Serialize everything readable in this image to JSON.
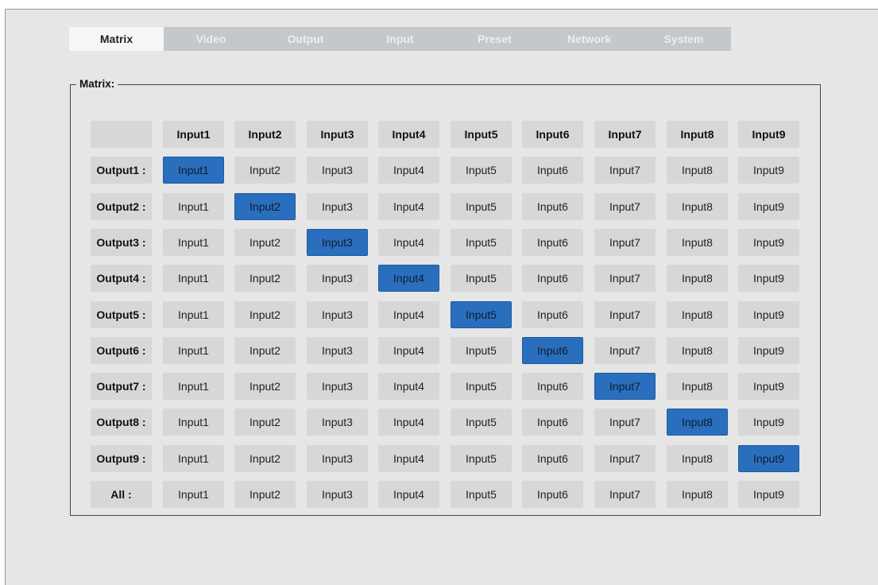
{
  "tabs": [
    "Matrix",
    "Video",
    "Output",
    "Input",
    "Preset",
    "Network",
    "System"
  ],
  "active_tab": "Matrix",
  "section_title": "Matrix:",
  "column_headers": [
    "Input1",
    "Input2",
    "Input3",
    "Input4",
    "Input5",
    "Input6",
    "Input7",
    "Input8",
    "Input9"
  ],
  "rows": [
    {
      "label": "Output1 :",
      "selected": 1
    },
    {
      "label": "Output2 :",
      "selected": 2
    },
    {
      "label": "Output3 :",
      "selected": 3
    },
    {
      "label": "Output4 :",
      "selected": 4
    },
    {
      "label": "Output5 :",
      "selected": 5
    },
    {
      "label": "Output6 :",
      "selected": 6
    },
    {
      "label": "Output7 :",
      "selected": 7
    },
    {
      "label": "Output8 :",
      "selected": 8
    },
    {
      "label": "Output9 :",
      "selected": 9
    },
    {
      "label": "All :",
      "selected": null
    }
  ],
  "button_labels": [
    "Input1",
    "Input2",
    "Input3",
    "Input4",
    "Input5",
    "Input6",
    "Input7",
    "Input8",
    "Input9"
  ],
  "colors": {
    "selected": "#2a6fbd",
    "button": "#d7d7d7",
    "tab_inactive": "#c4c7cc",
    "tab_active": "#f4f6f8",
    "panel": "#e6e6e6"
  }
}
